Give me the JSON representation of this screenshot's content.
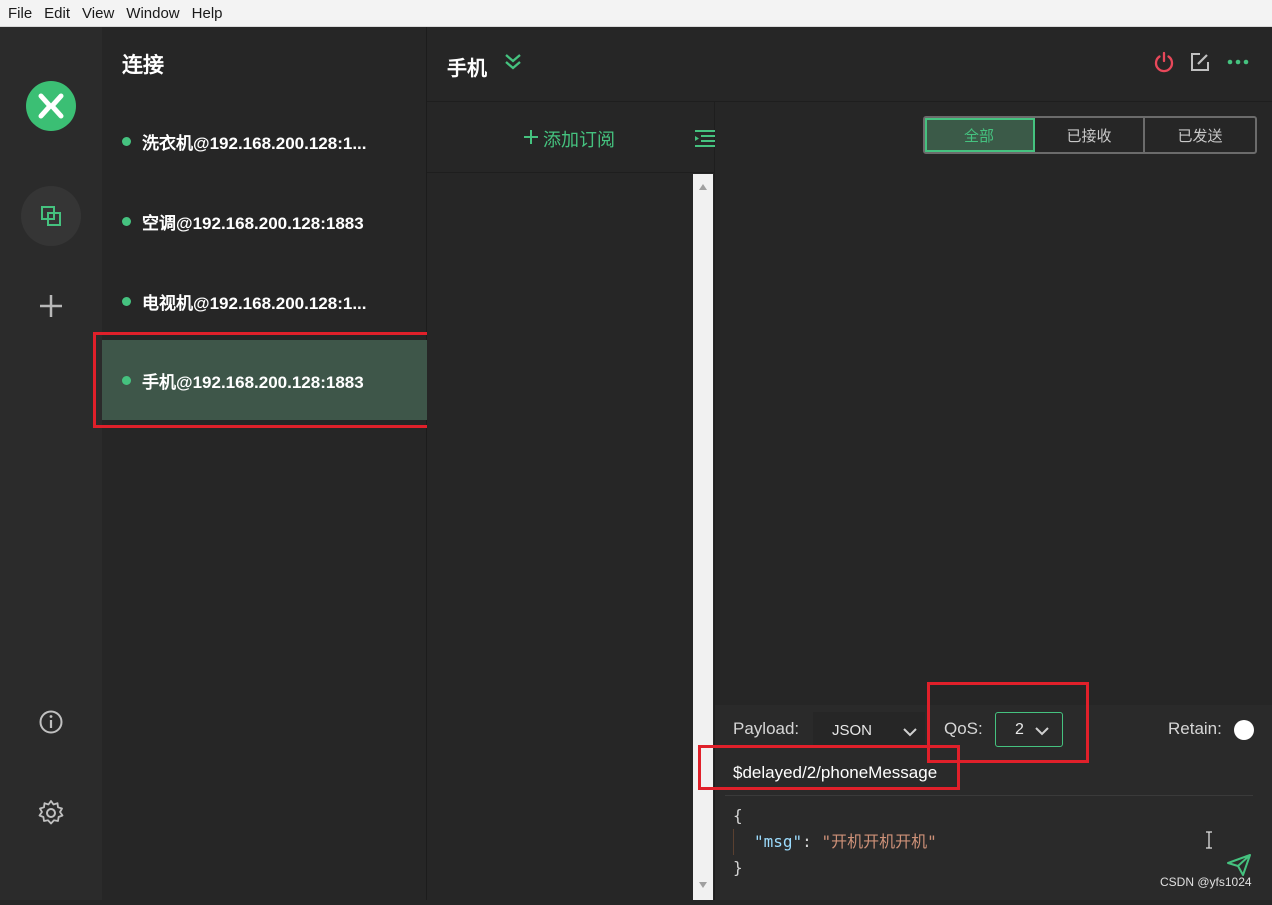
{
  "menu": {
    "items": [
      "File",
      "Edit",
      "View",
      "Window",
      "Help"
    ]
  },
  "connections": {
    "title": "连接",
    "items": [
      {
        "label": "洗衣机@192.168.200.128:1..."
      },
      {
        "label": "空调@192.168.200.128:1883"
      },
      {
        "label": "电视机@192.168.200.128:1..."
      },
      {
        "label": "手机@192.168.200.128:1883"
      }
    ]
  },
  "header": {
    "title": "手机"
  },
  "subscriptions": {
    "add_label": "添加订阅"
  },
  "filter": {
    "all": "全部",
    "received": "已接收",
    "sent": "已发送"
  },
  "publish": {
    "payload_label": "Payload:",
    "payload_format": "JSON",
    "qos_label": "QoS:",
    "qos_value": "2",
    "retain_label": "Retain:",
    "topic": "$delayed/2/phoneMessage",
    "code_open": "{",
    "code_key": "\"msg\"",
    "code_colon": ": ",
    "code_value": "\"开机开机开机\"",
    "code_close": "}"
  },
  "watermark": "CSDN @yfs1024",
  "colors": {
    "accent": "#45c27f",
    "danger": "#e8485a",
    "highlight": "#e0202a"
  },
  "icons": [
    "logo-icon",
    "connections-icon",
    "plus-icon",
    "info-icon",
    "gear-icon",
    "chevrons-down-icon",
    "power-icon",
    "edit-icon",
    "more-icon",
    "list-icon",
    "send-icon",
    "chevron-down-icon"
  ]
}
